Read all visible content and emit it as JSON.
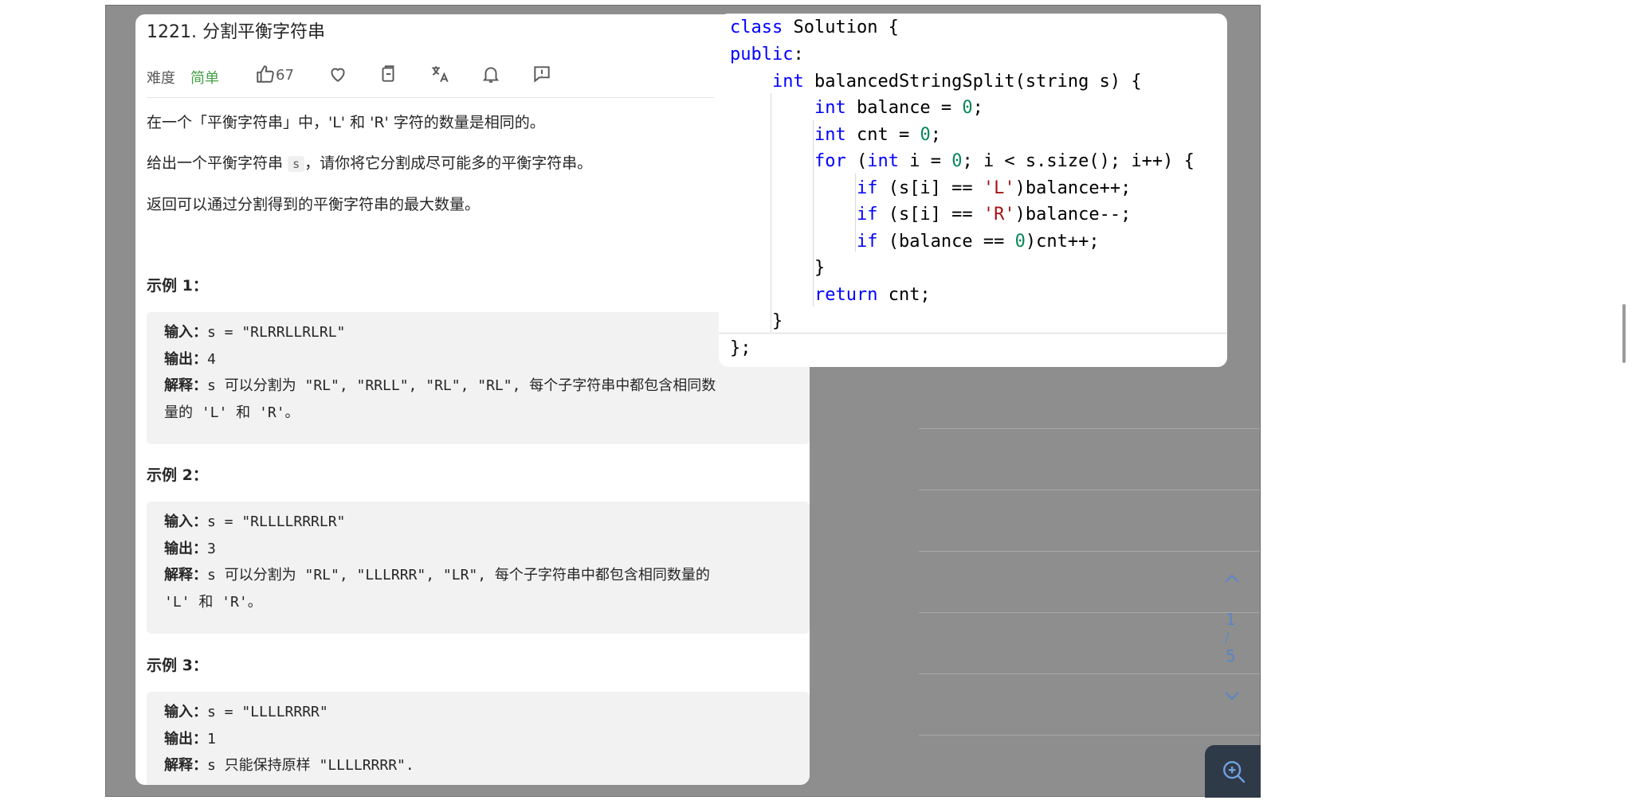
{
  "problem": {
    "title": "1221. 分割平衡字符串",
    "difficulty_label": "难度",
    "difficulty_value": "简单",
    "likes": "67",
    "desc_1": "在一个「平衡字符串」中，'L' 和 'R' 字符的数量是相同的。",
    "desc_2_pre": "给出一个平衡字符串",
    "desc_2_code": "s",
    "desc_2_post": "，请你将它分割成尽可能多的平衡字符串。",
    "desc_3": "返回可以通过分割得到的平衡字符串的最大数量。",
    "examples": [
      {
        "heading": "示例 1：",
        "input_label": "输入：",
        "input_value": "s = \"RLRRLLRLRL\"",
        "output_label": "输出：",
        "output_value": "4",
        "explain_label": "解释：",
        "explain_value_line1": "s 可以分割为 \"RL\", \"RRLL\", \"RL\", \"RL\", 每个子字符串中都包含相同数",
        "explain_value_line2": "量的 'L' 和 'R'。"
      },
      {
        "heading": "示例 2：",
        "input_label": "输入：",
        "input_value": "s = \"RLLLLRRRLR\"",
        "output_label": "输出：",
        "output_value": "3",
        "explain_label": "解释：",
        "explain_value_line1": "s 可以分割为 \"RL\", \"LLLRRR\", \"LR\", 每个子字符串中都包含相同数量的",
        "explain_value_line2": "'L' 和 'R'。"
      },
      {
        "heading": "示例 3：",
        "input_label": "输入：",
        "input_value": "s = \"LLLLRRRR\"",
        "output_label": "输出：",
        "output_value": "1",
        "explain_label": "解释：",
        "explain_value_line1": "s 只能保持原样 \"LLLLRRRR\"."
      }
    ]
  },
  "code": {
    "language": "cpp",
    "lines": [
      "class Solution {",
      "public:",
      "    int balancedStringSplit(string s) {",
      "        int balance = 0;",
      "        int cnt = 0;",
      "        for (int i = 0; i < s.size(); i++) {",
      "            if (s[i] == 'L')balance++;",
      "            if (s[i] == 'R')balance--;",
      "            if (balance == 0)cnt++;",
      "        }",
      "        return cnt;",
      "    }",
      "};"
    ]
  },
  "viewer": {
    "page_current": "1",
    "page_separator": "/",
    "page_total": "5",
    "icons": [
      "chevron-up-icon",
      "chevron-down-icon",
      "zoom-in-icon"
    ]
  },
  "colors": {
    "stage_bg": "#8e8e8e",
    "easy_green": "#43a047",
    "keyword_blue": "#0000ff",
    "number_green": "#098658",
    "string_red": "#a31515",
    "nav_blue": "#5a86c4",
    "zoom_button_bg": "#2f3a48"
  }
}
